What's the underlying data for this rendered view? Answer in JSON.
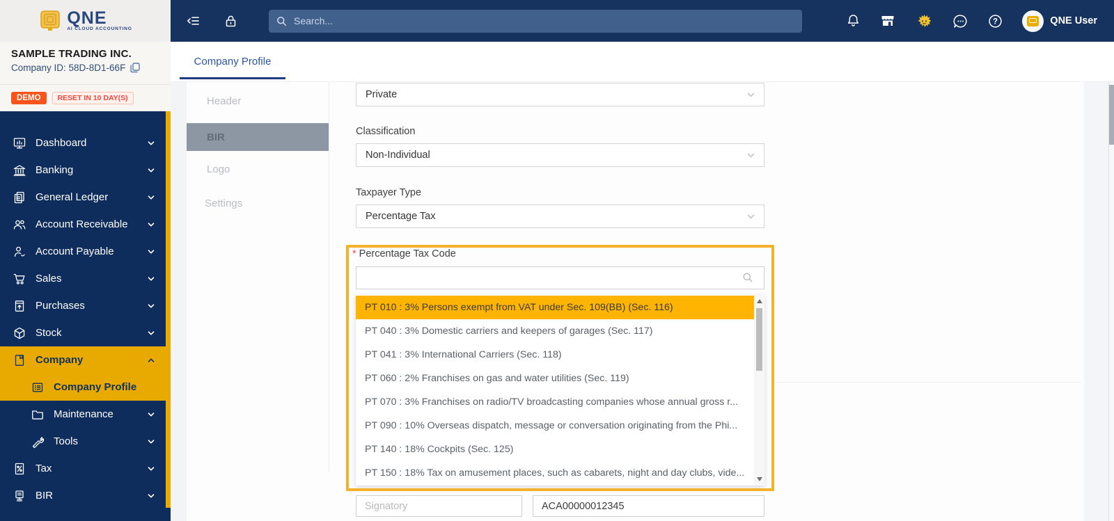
{
  "header": {
    "search_placeholder": "Search...",
    "user_name": "QNE User",
    "icons": [
      "collapse-menu-icon",
      "lock-icon",
      "search-icon",
      "bell-icon",
      "store-icon",
      "mascot-icon",
      "chat-icon",
      "help-icon",
      "avatar"
    ]
  },
  "sidebar": {
    "logo_title": "QNE",
    "logo_subtitle": "AI CLOUD ACCOUNTING",
    "company_name": "SAMPLE TRADING INC.",
    "company_id": "Company ID: 58D-8D1-66F",
    "demo_badge": "DEMO",
    "reset_badge": "RESET IN 10 DAY(S)",
    "items": [
      "Dashboard",
      "Banking",
      "General Ledger",
      "Account Receivable",
      "Account Payable",
      "Sales",
      "Purchases",
      "Stock",
      "Company",
      "Company Profile",
      "Maintenance",
      "Tools",
      "Tax",
      "BIR"
    ]
  },
  "main": {
    "tab_label": "Company Profile"
  },
  "subnav": {
    "items": [
      "Header",
      "BIR",
      "Logo",
      "Settings"
    ]
  },
  "form": {
    "private_value": "Private",
    "classification_label": "Classification",
    "classification_value": "Non-Individual",
    "taxpayer_type_label": "Taxpayer Type",
    "taxpayer_type_value": "Percentage Tax",
    "required_marker": "*",
    "percentage_tax_code_label": "Percentage Tax Code",
    "search_value": "",
    "options": [
      "PT 010 : 3% Persons exempt from VAT under Sec. 109(BB) (Sec. 116)",
      "PT 040 : 3% Domestic carriers and keepers of garages (Sec. 117)",
      "PT 041 : 3% International Carriers (Sec. 118)",
      "PT 060 : 2% Franchises on gas and water utilities (Sec. 119)",
      "PT 070 : 3% Franchises on radio/TV broadcasting companies whose annual gross r...",
      "PT 090 : 10% Overseas dispatch, message or conversation originating from the Phi...",
      "PT 140 : 18% Cockpits (Sec. 125)",
      "PT 150 : 18% Tax on amusement places, such as cabarets, night and day clubs, vide...",
      "Signatory",
      "ACA00000012345"
    ],
    "signatory_placeholder": "Signatory",
    "aca_value": "ACA00000012345"
  },
  "colors": {
    "header_navy": "#16325f",
    "sidebar_navy": "#0e2d5c",
    "accent_yellow": "#e9ab00",
    "selected_option_amber": "#ffb402",
    "highlight_border": "#f3b229",
    "demo_orange": "#fa541c",
    "tab_blue": "#2d54a3"
  }
}
